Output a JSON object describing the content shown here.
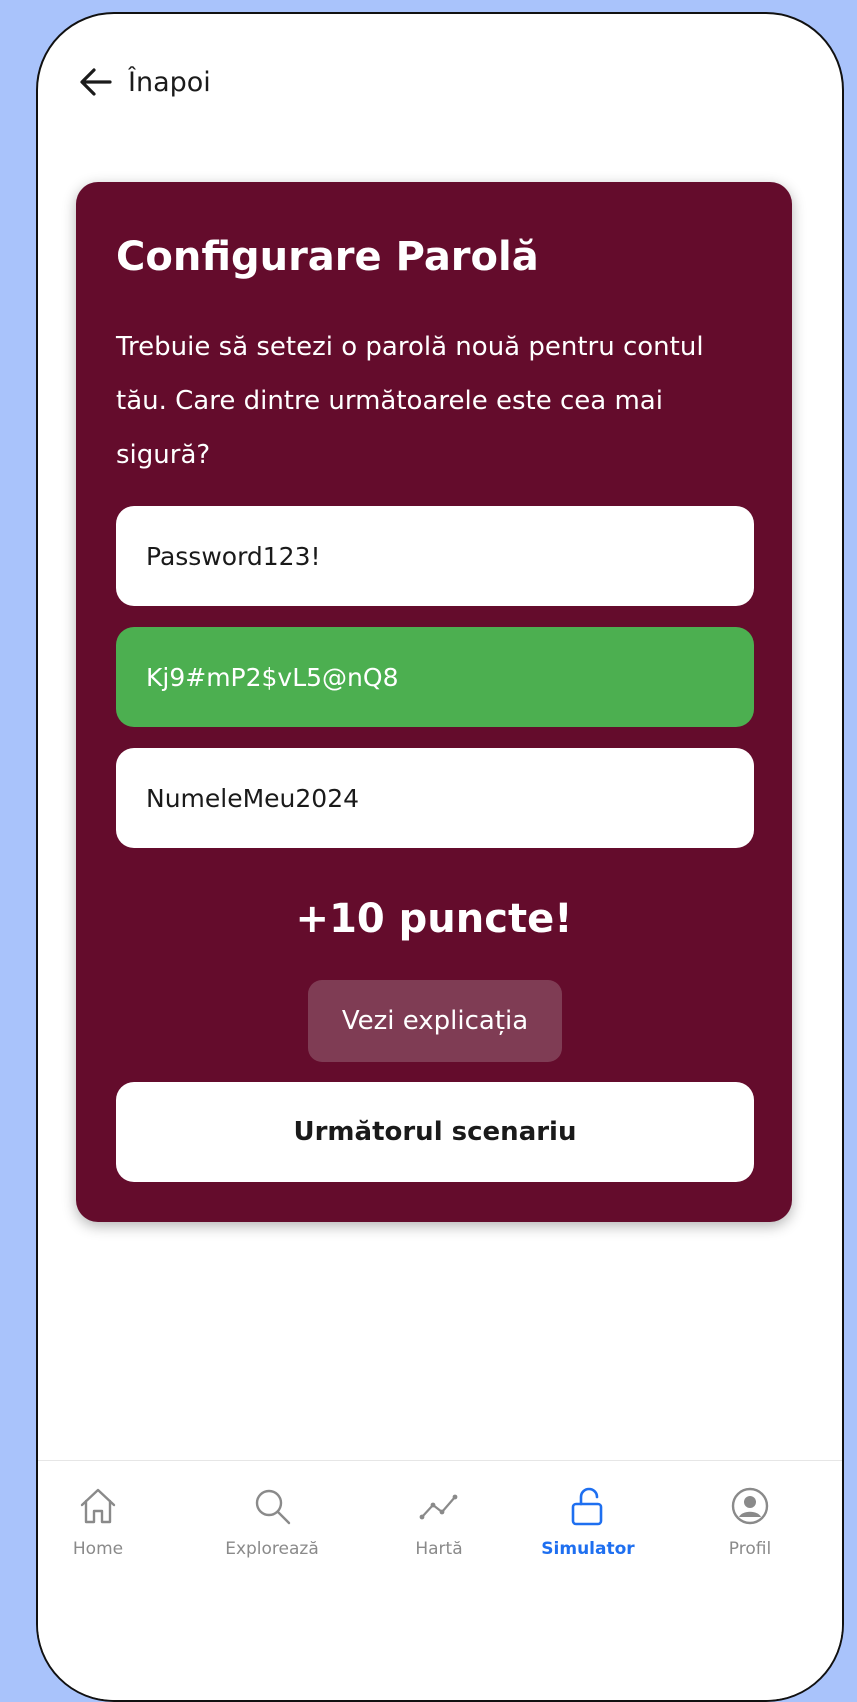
{
  "header": {
    "back_label": "Înapoi",
    "back_icon": "arrow-left-icon"
  },
  "card": {
    "title": "Configurare Parolă",
    "question": "Trebuie să setezi o parolă nouă pentru contul tău. Care dintre următoarele este cea mai sigură?",
    "options": [
      {
        "label": "Password123!",
        "state": "default"
      },
      {
        "label": "Kj9#mP2$vL5@nQ8",
        "state": "correct"
      },
      {
        "label": "NumeleMeu2024",
        "state": "default"
      }
    ],
    "points": "+10 puncte!",
    "explain_label": "Vezi explicația",
    "next_label": "Următorul scenariu"
  },
  "nav": {
    "items": [
      {
        "label": "Home",
        "icon": "home-icon",
        "active": false
      },
      {
        "label": "Explorează",
        "icon": "search-icon",
        "active": false
      },
      {
        "label": "Hartă",
        "icon": "chart-line-icon",
        "active": false
      },
      {
        "label": "Simulator",
        "icon": "lock-open-icon",
        "active": true
      },
      {
        "label": "Profil",
        "icon": "profile-icon",
        "active": false
      }
    ]
  },
  "colors": {
    "card_bg": "#640c2c",
    "correct_bg": "#4caf50",
    "explain_bg": "#7f3c54",
    "active_nav": "#1e6ff0",
    "page_bg": "#a9c3fb"
  }
}
